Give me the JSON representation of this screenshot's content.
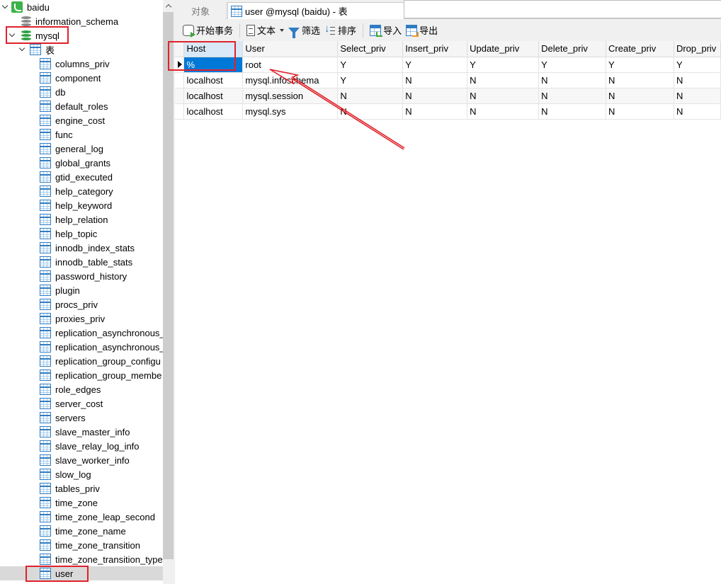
{
  "sidebar": {
    "connection": "baidu",
    "databases": [
      "information_schema",
      "mysql"
    ],
    "tables_group": "表",
    "tables": [
      "columns_priv",
      "component",
      "db",
      "default_roles",
      "engine_cost",
      "func",
      "general_log",
      "global_grants",
      "gtid_executed",
      "help_category",
      "help_keyword",
      "help_relation",
      "help_topic",
      "innodb_index_stats",
      "innodb_table_stats",
      "password_history",
      "plugin",
      "procs_priv",
      "proxies_priv",
      "replication_asynchronous_",
      "replication_asynchronous_",
      "replication_group_configu",
      "replication_group_membe",
      "role_edges",
      "server_cost",
      "servers",
      "slave_master_info",
      "slave_relay_log_info",
      "slave_worker_info",
      "slow_log",
      "tables_priv",
      "time_zone",
      "time_zone_leap_second",
      "time_zone_name",
      "time_zone_transition",
      "time_zone_transition_type",
      "user"
    ],
    "selected_table": "user"
  },
  "tabs": [
    {
      "label": "对象",
      "active": false
    },
    {
      "label": "user @mysql (baidu) - 表",
      "active": true
    }
  ],
  "toolbar": {
    "begin_transaction": "开始事务",
    "text": "文本",
    "filter": "筛选",
    "sort": "排序",
    "import": "导入",
    "export": "导出"
  },
  "grid": {
    "columns": [
      "Host",
      "User",
      "Select_priv",
      "Insert_priv",
      "Update_priv",
      "Delete_priv",
      "Create_priv",
      "Drop_priv"
    ],
    "rows": [
      [
        "%",
        "root",
        "Y",
        "Y",
        "Y",
        "Y",
        "Y",
        "Y"
      ],
      [
        "localhost",
        "mysql.infoschema",
        "Y",
        "N",
        "N",
        "N",
        "N",
        "N"
      ],
      [
        "localhost",
        "mysql.session",
        "N",
        "N",
        "N",
        "N",
        "N",
        "N"
      ],
      [
        "localhost",
        "mysql.sys",
        "N",
        "N",
        "N",
        "N",
        "N",
        "N"
      ]
    ],
    "selected_row": 0
  },
  "colors": {
    "selection": "#0078d7",
    "annotation": "#e0212b",
    "table_icon": "#2f7cc2",
    "db_active": "#3cb34a"
  }
}
